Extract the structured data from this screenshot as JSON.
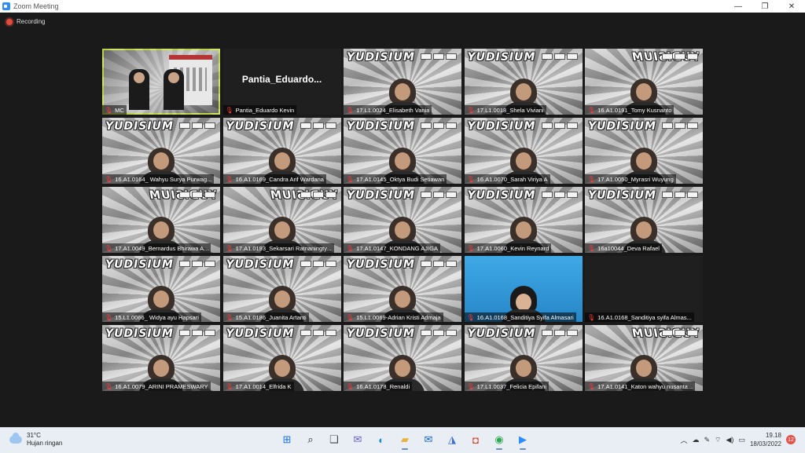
{
  "window": {
    "title": "Zoom Meeting",
    "controls": {
      "minimize": "—",
      "maximize": "❐",
      "close": "✕"
    }
  },
  "recording": {
    "label": "Recording",
    "color": "#e24a3b"
  },
  "tiles": [
    {
      "label": "MC",
      "kind": "mc"
    },
    {
      "label": "Pantia_Eduardo Kevin",
      "kind": "name-only",
      "bigname": "Pantia_Eduardo..."
    },
    {
      "label": "17.L1.0024_Elisabeth Vania",
      "kind": "bg",
      "banner": "YUDISIUM"
    },
    {
      "label": "17.L1.0018_Shela Viviani",
      "kind": "bg",
      "banner": "YUDISIUM"
    },
    {
      "label": "16.A1.0191_Tomy Kusnanto",
      "kind": "bg",
      "banner": "YUDISIUM",
      "mirror": true
    },
    {
      "label": "16.A1.0164_ Wahyu Surya Purwag...",
      "kind": "bg",
      "banner": "YUDISIUM"
    },
    {
      "label": "16.A1.0169_Candra Arif Wardana",
      "kind": "bg",
      "banner": "YUDISIUM"
    },
    {
      "label": "17.A1.0145_Oktya Budi Setiawan",
      "kind": "bg",
      "banner": "YUDISIUM"
    },
    {
      "label": "16.A1.0070_Sarah Viriya A",
      "kind": "bg",
      "banner": "YUDISIUM"
    },
    {
      "label": "17.A1.0050_Myrasri Wuyung",
      "kind": "bg",
      "banner": "YUDISIUM"
    },
    {
      "label": "17.A1.0049_Bernardus Bhirawa A...",
      "kind": "bg",
      "banner": "YUDISIUM",
      "mirror": true
    },
    {
      "label": "17.A1.0193_Sekarsari Ratnaningty...",
      "kind": "bg",
      "banner": "YUDISIUM",
      "mirror": true
    },
    {
      "label": "17.A1.0147_KONDANG AJIGA",
      "kind": "bg",
      "banner": "YUDISIUM"
    },
    {
      "label": "17.A1.0060_Kevin Reynard",
      "kind": "bg",
      "banner": "YUDISIUM"
    },
    {
      "label": "16a10044_Deva Rafael",
      "kind": "bg",
      "banner": "YUDISIUM"
    },
    {
      "label": "15.L1.0066_ Widya ayu Hapsari",
      "kind": "bg",
      "banner": "YUDISIUM"
    },
    {
      "label": "15.A1.0186_Juanita Artanti",
      "kind": "bg",
      "banner": "YUDISIUM"
    },
    {
      "label": "15.L1.0069-Adrian Kristi Admaja",
      "kind": "bg",
      "banner": "YUDISIUM"
    },
    {
      "label": "16.A1.0168_Sanditiya Syifa Almasari",
      "kind": "blue"
    },
    {
      "label": "16.A1.0168_Sanditiya syifa Almas...",
      "kind": "plain"
    },
    {
      "label": "16.A1.0079_ARINI PRAMESWARY",
      "kind": "bg",
      "banner": "YUDISIUM"
    },
    {
      "label": "17.A1.0014_Elfrida K",
      "kind": "bg",
      "banner": "YUDISIUM"
    },
    {
      "label": "16.A1.0178_Renaldi",
      "kind": "bg",
      "banner": "YUDISIUM"
    },
    {
      "label": "17.L1.0037_Felicia Epifani",
      "kind": "bg",
      "banner": "YUDISIUM"
    },
    {
      "label": "17.A1.0141_Katon wahyu nusanta...",
      "kind": "bg",
      "banner": "YUDISIUM",
      "mirror": true
    }
  ],
  "taskbar": {
    "weather": {
      "temp": "31°C",
      "condition": "Hujan ringan"
    },
    "apps": [
      {
        "name": "start-icon",
        "glyph": "⊞",
        "color": "#1a73e8"
      },
      {
        "name": "search-icon",
        "glyph": "⌕",
        "color": "#222"
      },
      {
        "name": "task-view-icon",
        "glyph": "❑",
        "color": "#444"
      },
      {
        "name": "chat-icon",
        "glyph": "✉",
        "color": "#6a5acd"
      },
      {
        "name": "edge-icon",
        "glyph": "◐",
        "color": "#1b8fd6"
      },
      {
        "name": "file-explorer-icon",
        "glyph": "▰",
        "color": "#e8b33a"
      },
      {
        "name": "mail-icon",
        "glyph": "✉",
        "color": "#1463c9"
      },
      {
        "name": "store-icon",
        "glyph": "◮",
        "color": "#3b6fd1"
      },
      {
        "name": "office-icon",
        "glyph": "◘",
        "color": "#d6452b"
      },
      {
        "name": "chrome-icon",
        "glyph": "◉",
        "color": "#34a853"
      },
      {
        "name": "zoom-icon",
        "glyph": "▶",
        "color": "#2d8cff"
      }
    ],
    "tray": {
      "time": "19.18",
      "date": "18/03/2022",
      "notifications": "12"
    }
  }
}
